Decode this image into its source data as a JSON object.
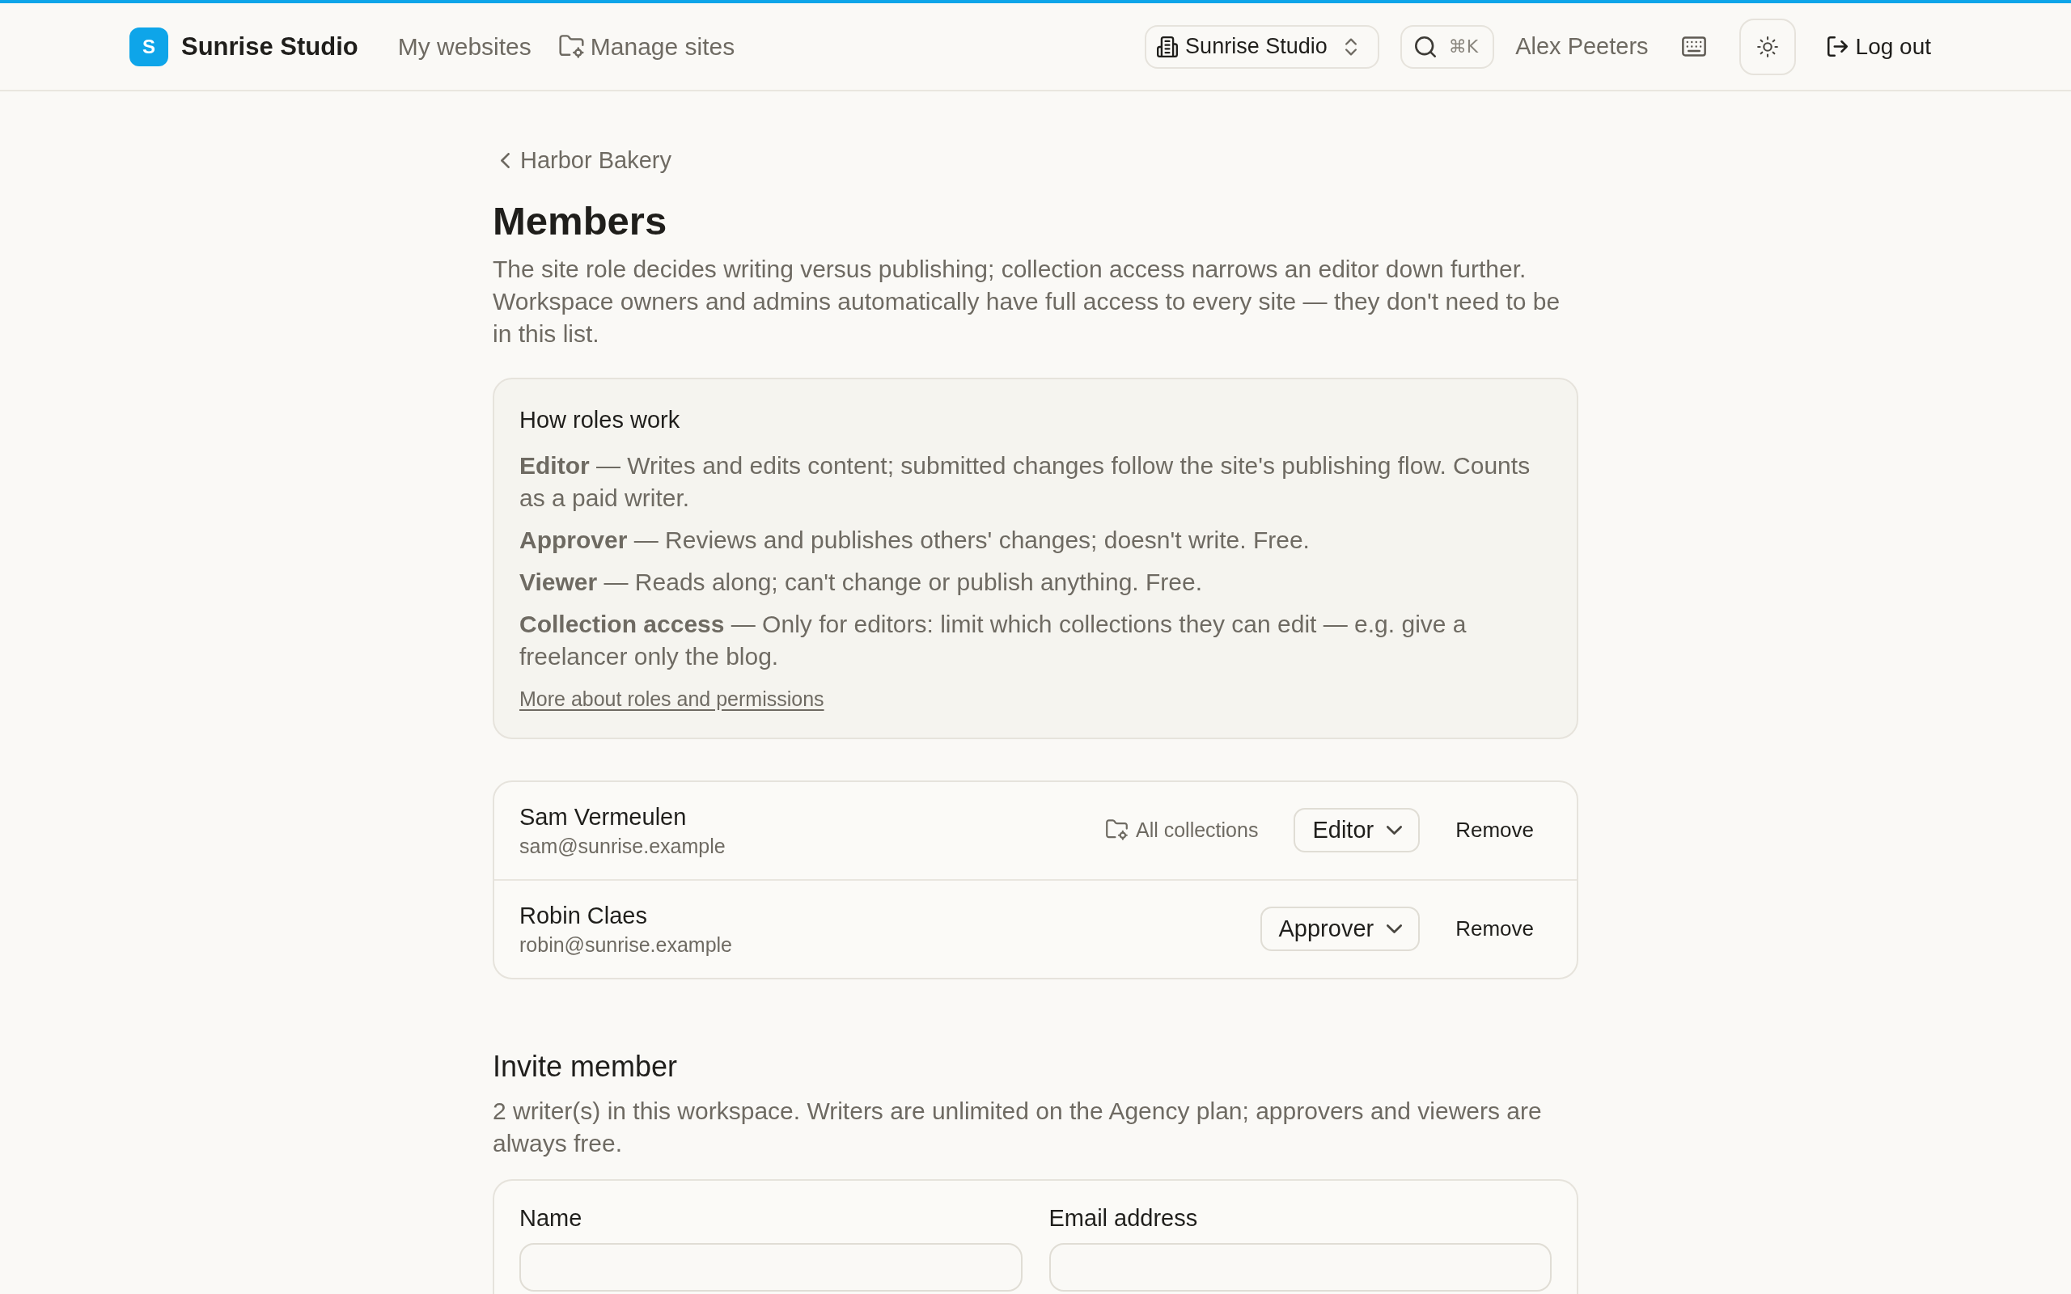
{
  "header": {
    "brand": {
      "initial": "S",
      "name": "Sunrise Studio"
    },
    "nav": [
      {
        "kind": "text",
        "label": "My websites"
      },
      {
        "kind": "icon_text",
        "label": "Manage sites"
      }
    ],
    "workspace_switcher": {
      "label": "Sunrise Studio"
    },
    "search": {
      "shortcut": "⌘K"
    },
    "user_name": "Alex Peeters",
    "logout": {
      "label": "Log out"
    }
  },
  "breadcrumb": {
    "label": "Harbor Bakery"
  },
  "title": "Members",
  "description": "The site role decides writing versus publishing; collection access narrows an editor down further. Workspace owners and admins automatically have full access to every site — they don't need to be in this list.",
  "roles_help": {
    "title": "How roles work",
    "items": [
      "**Editor** — Writes and edits content; submitted changes follow the site's publishing flow. Counts as a paid writer.",
      "**Approver** — Reviews and publishes others' changes; doesn't write. Free.",
      "**Viewer** — Reads along; can't change or publish anything. Free.",
      "**Collection access** — Only for editors: limit which collections they can edit — e.g. give a freelancer only the blog."
    ],
    "link": "More about roles and permissions"
  },
  "members": [
    {
      "name": "Sam Vermeulen",
      "email": "sam@sunrise.example",
      "collection_access": "All collections",
      "role": "Editor",
      "remove_label": "Remove"
    },
    {
      "name": "Robin Claes",
      "email": "robin@sunrise.example",
      "role": "Approver",
      "remove_label": "Remove"
    }
  ],
  "invite": {
    "title": "Invite member",
    "description": "2 writer(s) in this workspace. Writers are unlimited on the Agency plan; approvers and viewers are always free.",
    "fields": [
      {
        "label": "Name"
      },
      {
        "label": "Email address"
      }
    ]
  }
}
